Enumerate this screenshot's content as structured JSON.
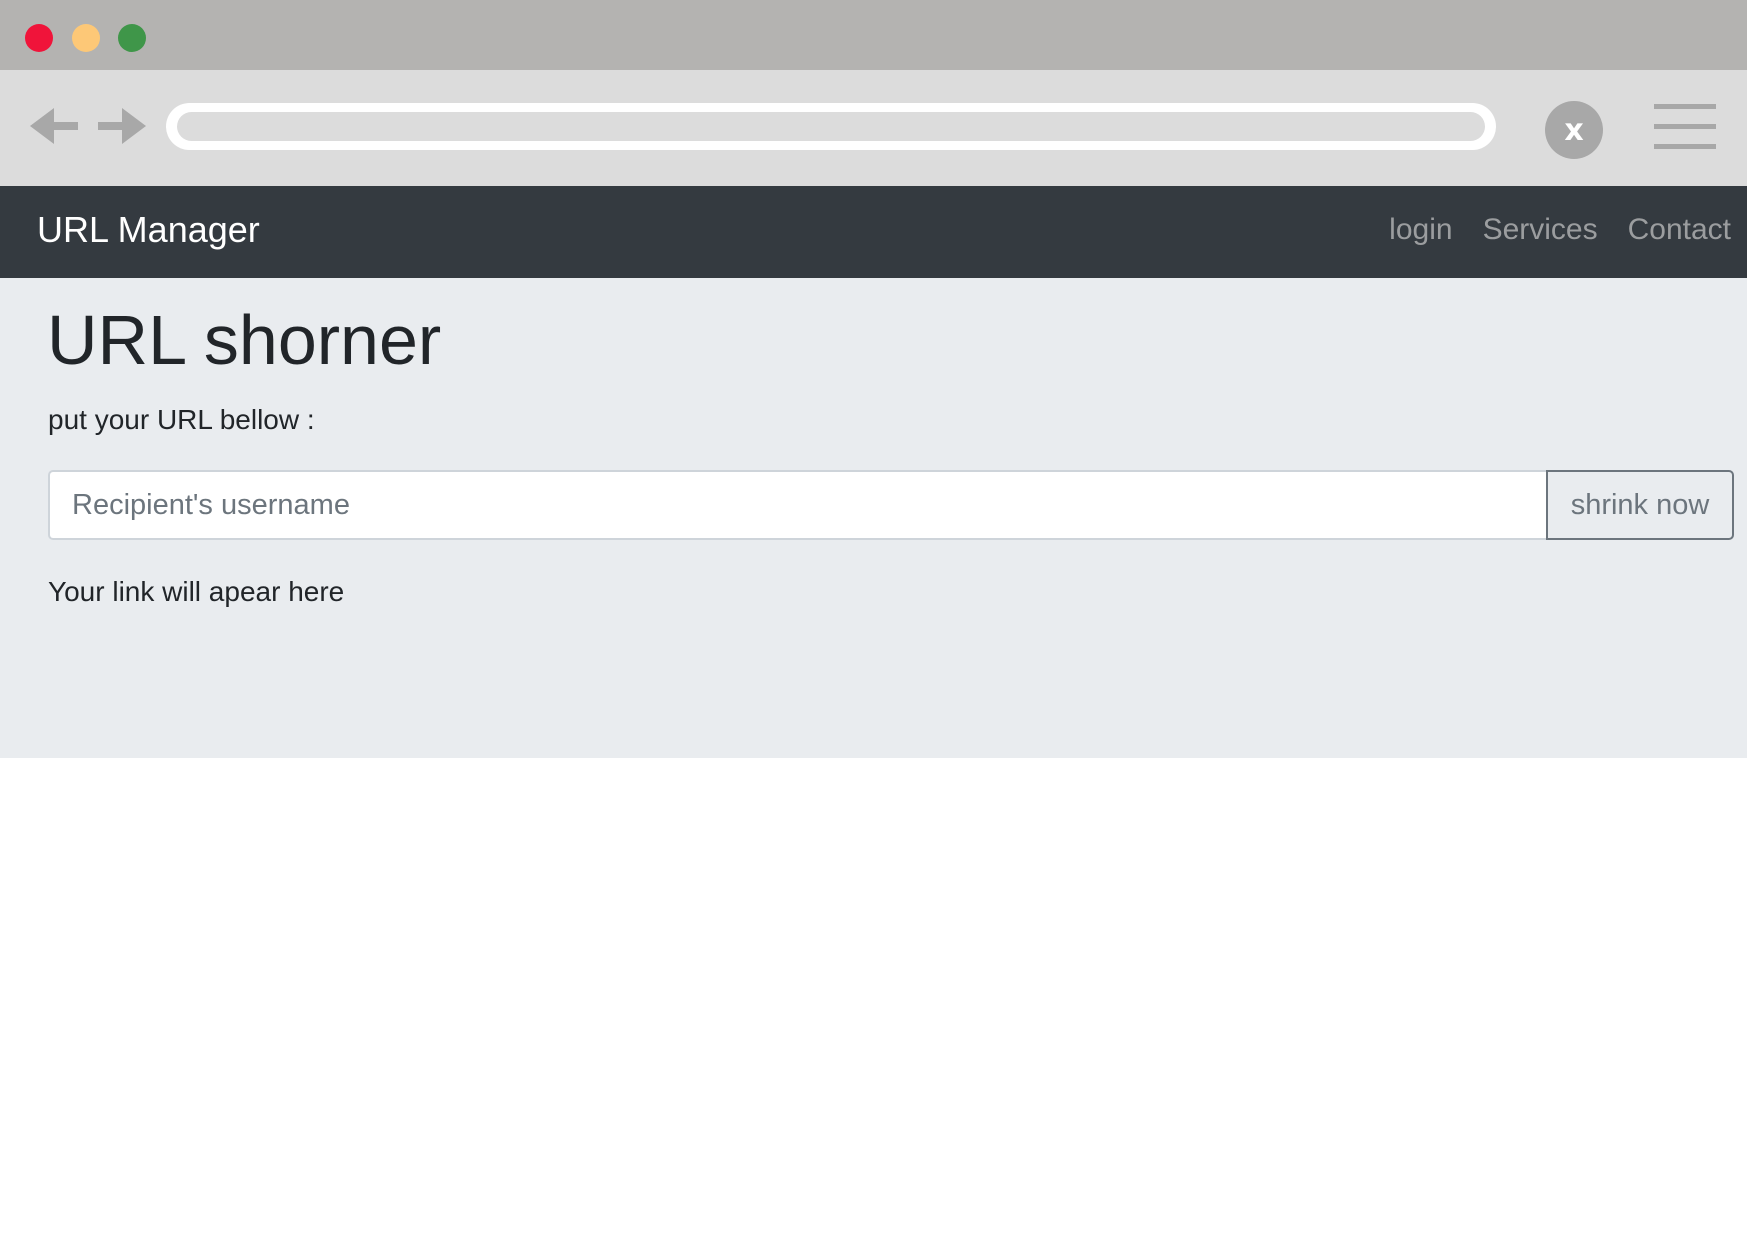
{
  "window": {
    "controls": [
      "close",
      "minimize",
      "maximize"
    ],
    "colors": {
      "close": "#f0143a",
      "minimize": "#fdc877",
      "maximize": "#3f9649"
    }
  },
  "browser": {
    "back_icon": "arrow-left-icon",
    "forward_icon": "arrow-right-icon",
    "address": "",
    "stop_label": "x",
    "menu_icon": "hamburger-menu-icon"
  },
  "navbar": {
    "brand": "URL Manager",
    "links": [
      "login",
      "Services",
      "Contact"
    ],
    "background": "#343a40"
  },
  "main": {
    "title": "URL shorner",
    "lead": "put your URL bellow :",
    "input": {
      "value": "",
      "placeholder": "Recipient's username"
    },
    "button_label": "shrink now",
    "result": "Your link will apear here",
    "background": "#e9ecef"
  }
}
